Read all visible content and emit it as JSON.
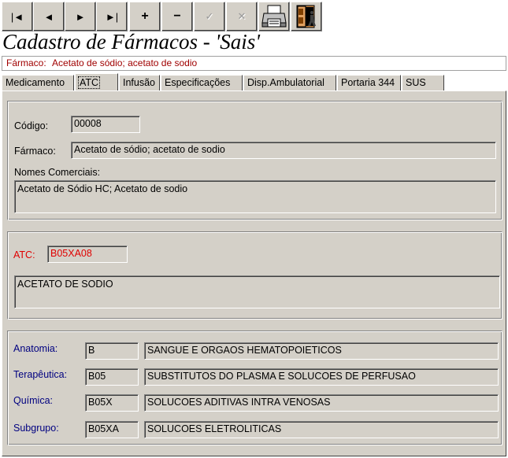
{
  "toolbar": {
    "first": "|◄",
    "prev": "◄",
    "next": "►",
    "last": "►|",
    "add": "+",
    "remove": "−",
    "confirm": "✓",
    "cancel": "✕"
  },
  "form": {
    "title": "Cadastro de Fármacos - 'Sais'",
    "farmaco_label": "Fármaco:",
    "farmaco_value": "Acetato de sódio; acetato de sodio"
  },
  "tabs": [
    {
      "label": "Medicamento"
    },
    {
      "label": "ATC"
    },
    {
      "label": "Infusão"
    },
    {
      "label": "Especificações"
    },
    {
      "label": "Disp.Ambulatorial"
    },
    {
      "label": "Portaria 344"
    },
    {
      "label": "SUS"
    }
  ],
  "active_tab": "ATC",
  "general": {
    "codigo_label": "Código:",
    "codigo_value": "00008",
    "farmaco_label": "Fármaco:",
    "farmaco_value": "Acetato de sódio; acetato de sodio",
    "nomes_label": "Nomes Comerciais:",
    "nomes_value": "Acetato de Sódio HC; Acetato de sodio"
  },
  "atc": {
    "label": "ATC:",
    "code": "B05XA08",
    "description": "ACETATO DE SODIO"
  },
  "classification": [
    {
      "label": "Anatomia:",
      "code": "B",
      "description": "SANGUE E ORGAOS HEMATOPOIETICOS"
    },
    {
      "label": "Terapêutica:",
      "code": "B05",
      "description": "SUBSTITUTOS DO PLASMA E SOLUCOES DE PERFUSAO"
    },
    {
      "label": "Química:",
      "code": "B05X",
      "description": "SOLUCOES ADITIVAS INTRA VENOSAS"
    },
    {
      "label": "Subgrupo:",
      "code": "B05XA",
      "description": "SOLUCOES ELETROLITICAS"
    }
  ],
  "colors": {
    "panel": "#d4d0c8",
    "atc_red": "#e00000",
    "class_blue": "#000080",
    "header_red": "#a00000"
  }
}
